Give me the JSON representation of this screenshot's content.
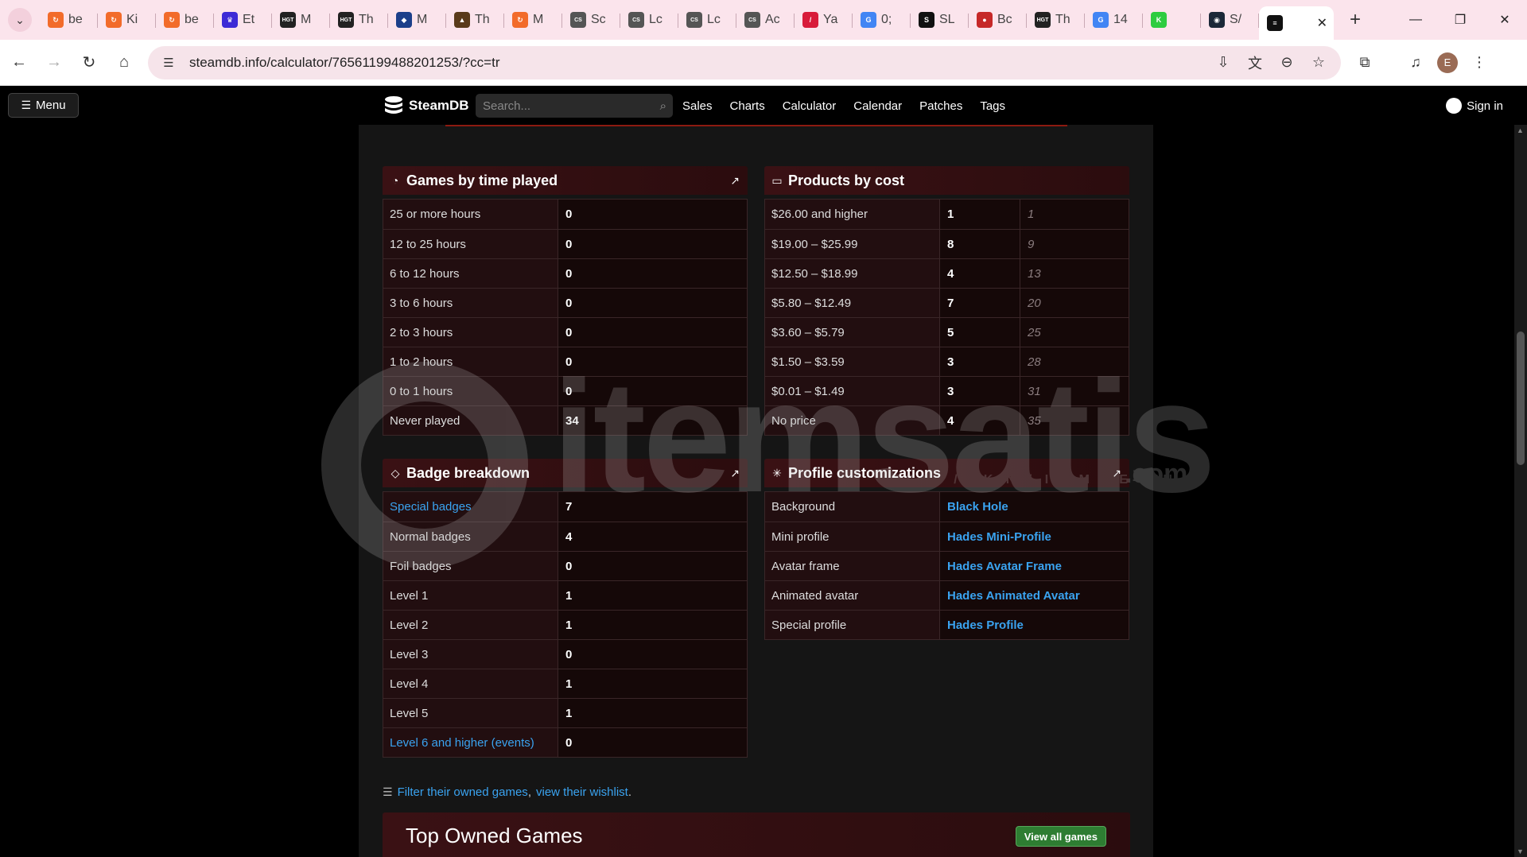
{
  "browser": {
    "tabs": [
      {
        "title": "be",
        "icon": "cycle-icon",
        "color": "#f26b2a"
      },
      {
        "title": "Ki",
        "icon": "cycle-icon",
        "color": "#f26b2a"
      },
      {
        "title": "be",
        "icon": "cycle-icon",
        "color": "#f26b2a"
      },
      {
        "title": "Et",
        "icon": "crown-icon",
        "color": "#3d2bd6"
      },
      {
        "title": "M",
        "icon": "hgt-icon",
        "color": "#222222"
      },
      {
        "title": "Th",
        "icon": "hgt-icon",
        "color": "#222222"
      },
      {
        "title": "M",
        "icon": "shield-icon",
        "color": "#1c3f8a"
      },
      {
        "title": "Th",
        "icon": "hat-icon",
        "color": "#5a3a1a"
      },
      {
        "title": "M",
        "icon": "cycle-icon",
        "color": "#f26b2a"
      },
      {
        "title": "Sc",
        "icon": "csgo-icon",
        "color": "#555555"
      },
      {
        "title": "Lc",
        "icon": "csgo-icon",
        "color": "#555555"
      },
      {
        "title": "Lc",
        "icon": "csgo-icon",
        "color": "#555555"
      },
      {
        "title": "Ac",
        "icon": "csgo-icon",
        "color": "#555555"
      },
      {
        "title": "Ya",
        "icon": "slash-icon",
        "color": "#d81b3a"
      },
      {
        "title": "0;",
        "icon": "google-icon",
        "color": "#4285f4"
      },
      {
        "title": "SL",
        "icon": "s-icon",
        "color": "#111111"
      },
      {
        "title": "Bc",
        "icon": "ball-icon",
        "color": "#c62828"
      },
      {
        "title": "Th",
        "icon": "hgt-icon",
        "color": "#222222"
      },
      {
        "title": "14",
        "icon": "google-icon",
        "color": "#4285f4"
      },
      {
        "title": "",
        "icon": "k-icon",
        "color": "#2ecc40"
      },
      {
        "title": "S/",
        "icon": "steam-icon",
        "color": "#1b2838"
      }
    ],
    "active_tab": {
      "title": "",
      "icon": "steamdb-icon"
    },
    "url": "steamdb.info/calculator/76561199488201253/?cc=tr",
    "profile_initial": "E"
  },
  "site": {
    "menu_label": "Menu",
    "logo_text": "SteamDB",
    "search_placeholder": "Search...",
    "nav": [
      "Sales",
      "Charts",
      "Calculator",
      "Calendar",
      "Patches",
      "Tags"
    ],
    "signin": "Sign in"
  },
  "games_by_time": {
    "title": "Games by time played",
    "rows": [
      {
        "label": "25 or more hours",
        "value": "0"
      },
      {
        "label": "12 to 25 hours",
        "value": "0"
      },
      {
        "label": "6 to 12 hours",
        "value": "0"
      },
      {
        "label": "3 to 6 hours",
        "value": "0"
      },
      {
        "label": "2 to 3 hours",
        "value": "0"
      },
      {
        "label": "1 to 2 hours",
        "value": "0"
      },
      {
        "label": "0 to 1 hours",
        "value": "0"
      },
      {
        "label": "Never played",
        "value": "34"
      }
    ]
  },
  "products_by_cost": {
    "title": "Products by cost",
    "rows": [
      {
        "label": "$26.00 and higher",
        "value": "1",
        "cumulative": "1"
      },
      {
        "label": "$19.00 – $25.99",
        "value": "8",
        "cumulative": "9"
      },
      {
        "label": "$12.50 – $18.99",
        "value": "4",
        "cumulative": "13"
      },
      {
        "label": "$5.80 – $12.49",
        "value": "7",
        "cumulative": "20"
      },
      {
        "label": "$3.60 – $5.79",
        "value": "5",
        "cumulative": "25"
      },
      {
        "label": "$1.50 – $3.59",
        "value": "3",
        "cumulative": "28"
      },
      {
        "label": "$0.01 – $1.49",
        "value": "3",
        "cumulative": "31"
      },
      {
        "label": "No price",
        "value": "4",
        "cumulative": "35"
      }
    ]
  },
  "badge_breakdown": {
    "title": "Badge breakdown",
    "rows": [
      {
        "label": "Special badges",
        "value": "7",
        "link": true
      },
      {
        "label": "Normal badges",
        "value": "4",
        "link": false
      },
      {
        "label": "Foil badges",
        "value": "0",
        "link": false
      },
      {
        "label": "Level 1",
        "value": "1",
        "link": false
      },
      {
        "label": "Level 2",
        "value": "1",
        "link": false
      },
      {
        "label": "Level 3",
        "value": "0",
        "link": false
      },
      {
        "label": "Level 4",
        "value": "1",
        "link": false
      },
      {
        "label": "Level 5",
        "value": "1",
        "link": false
      },
      {
        "label": "Level 6 and higher (events)",
        "value": "0",
        "link": true
      }
    ]
  },
  "profile_customizations": {
    "title": "Profile customizations",
    "rows": [
      {
        "label": "Background",
        "value": "Black Hole"
      },
      {
        "label": "Mini profile",
        "value": "Hades Mini-Profile"
      },
      {
        "label": "Avatar frame",
        "value": "Hades Avatar Frame"
      },
      {
        "label": "Animated avatar",
        "value": "Hades Animated Avatar"
      },
      {
        "label": "Special profile",
        "value": "Hades Profile"
      }
    ]
  },
  "filter_line": {
    "filter_link": "Filter their owned games",
    "separator": ",",
    "wishlist_link": "view their wishlist",
    "end": "."
  },
  "top_owned": {
    "title": "Top Owned Games",
    "button": "View all games"
  },
  "watermark": {
    "text": "itemsatis",
    "sub": "HESAP / SKIN / ITEM / E-PIN",
    "com": ".com"
  },
  "colors": {
    "accent_link": "#3aa3f0",
    "panel_header": "#3a1114",
    "button_green": "#2e7d32"
  }
}
